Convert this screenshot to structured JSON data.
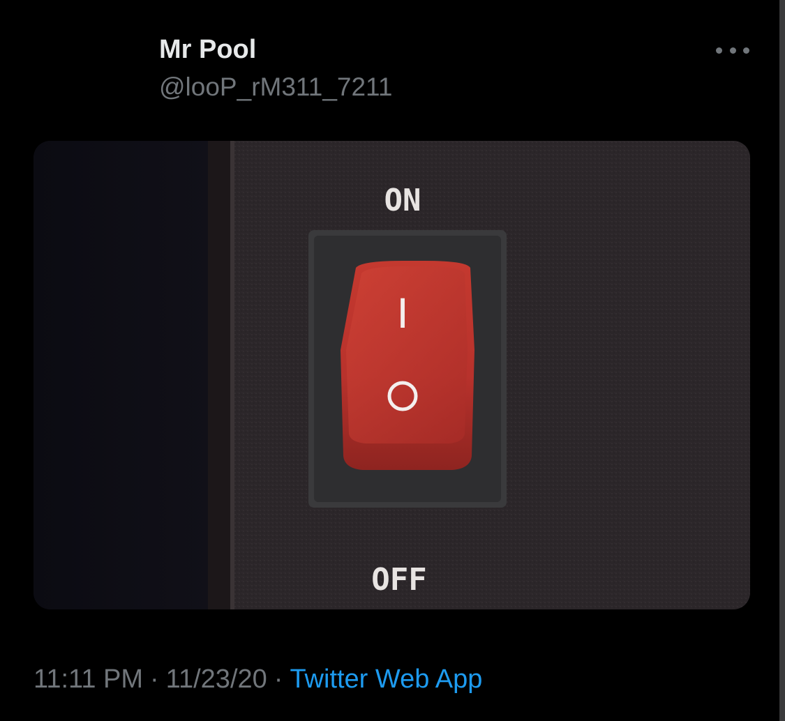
{
  "tweet": {
    "display_name": "Mr Pool",
    "handle": "@looP_rM311_7211",
    "more_icon": "more-horizontal-icon",
    "media": {
      "switch_label_on": "ON",
      "switch_label_off": "OFF",
      "rocker_on_symbol": "I",
      "rocker_off_symbol": "O",
      "colors": {
        "panel": "#2b2629",
        "rocker": "#b8322c",
        "bezel": "#3a3a3c"
      }
    },
    "time": "11:11 PM",
    "separator": "·",
    "date": "11/23/20",
    "source": "Twitter Web App"
  },
  "colors": {
    "background": "#000000",
    "primary_text": "#e7e9ea",
    "secondary_text": "#71767b",
    "link": "#1d9bf0"
  }
}
